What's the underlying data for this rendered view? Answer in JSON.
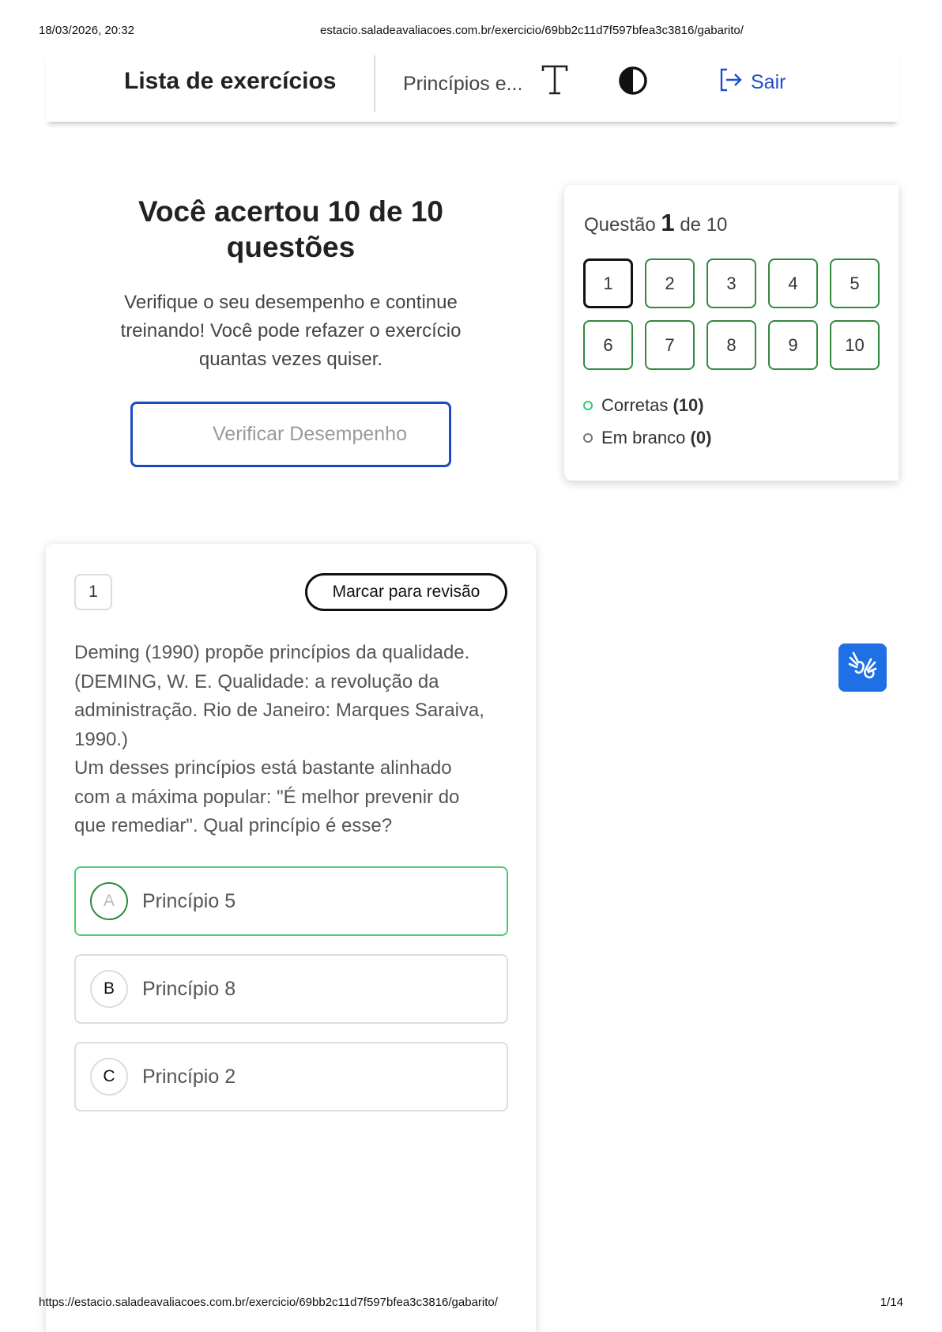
{
  "print_header": {
    "date": "18/03/2026, 20:32",
    "url": "estacio.saladeavaliacoes.com.br/exercicio/69bb2c11d7f597bfea3c3816/gabarito/"
  },
  "print_footer": {
    "url": "https://estacio.saladeavaliacoes.com.br/exercicio/69bb2c11d7f597bfea3c3816/gabarito/",
    "page": "1/14"
  },
  "topbar": {
    "title": "Lista de exercícios",
    "subject": "Princípios e...",
    "font_icon": "text-size-icon",
    "contrast_icon": "contrast-icon",
    "exit_icon": "logout-icon",
    "exit_label": "Sair",
    "accent_color": "#1f4fc9"
  },
  "result": {
    "heading": "Você acertou 10 de 10 questões",
    "message": "Verifique o seu desempenho e continue treinando! Você pode refazer o exercício quantas vezes quiser.",
    "button_label": "Verificar Desempenho"
  },
  "navigator": {
    "prefix": "Questão",
    "current": "1",
    "suffix": "de 10",
    "questions": [
      "1",
      "2",
      "3",
      "4",
      "5",
      "6",
      "7",
      "8",
      "9",
      "10"
    ],
    "legend": [
      {
        "label": "Corretas",
        "count": "(10)",
        "color": "#2ecc71"
      },
      {
        "label": "Em branco",
        "count": "(0)",
        "color": "#777777"
      }
    ]
  },
  "question": {
    "number": "1",
    "review_label": "Marcar para revisão",
    "text_lines": [
      "Deming (1990) propõe princípios da qualidade.",
      "(DEMING, W. E. Qualidade: a revolução da",
      "administração. Rio de Janeiro: Marques Saraiva,",
      "1990.)",
      "Um desses princípios está bastante alinhado",
      "com a máxima popular: \"É melhor prevenir do",
      "que remediar\". Qual princípio é esse?"
    ],
    "options": [
      {
        "letter": "A",
        "label": "Princípio 5",
        "correct": true
      },
      {
        "letter": "B",
        "label": "Princípio 8",
        "correct": false
      },
      {
        "letter": "C",
        "label": "Princípio 2",
        "correct": false
      }
    ],
    "correct_color": "#4ccc6c"
  },
  "libras_button": {
    "icon": "sign-language-hands-icon",
    "color": "#1f6fe5"
  }
}
